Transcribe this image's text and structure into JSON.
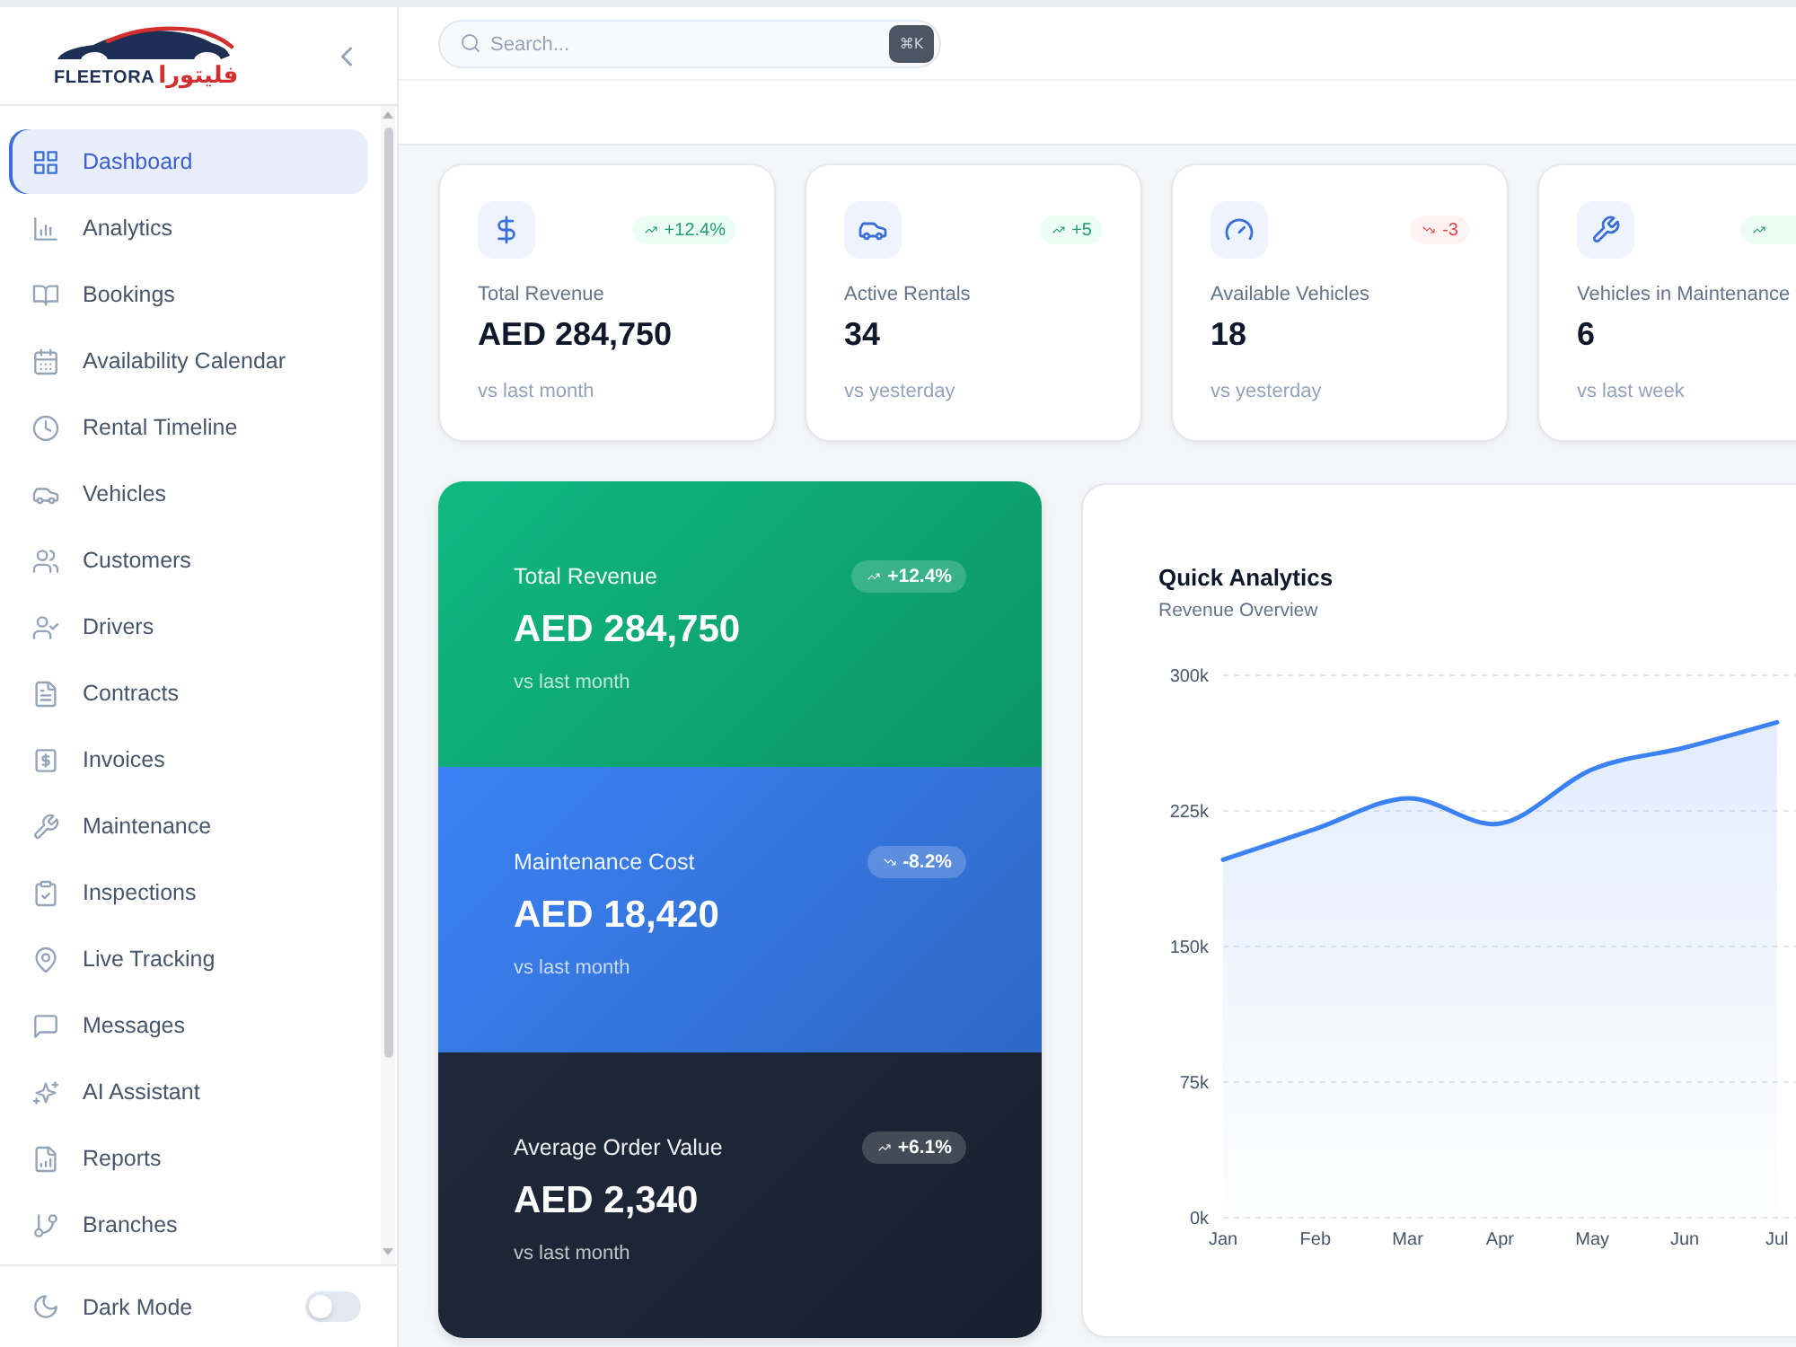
{
  "brand": {
    "name": "FLEETORA",
    "name_arabic": "فليتورا"
  },
  "sidebar": {
    "items": [
      {
        "label": "Dashboard",
        "selected": true
      },
      {
        "label": "Analytics",
        "selected": false
      },
      {
        "label": "Bookings",
        "selected": false
      },
      {
        "label": "Availability Calendar",
        "selected": false
      },
      {
        "label": "Rental Timeline",
        "selected": false
      },
      {
        "label": "Vehicles",
        "selected": false
      },
      {
        "label": "Customers",
        "selected": false
      },
      {
        "label": "Drivers",
        "selected": false
      },
      {
        "label": "Contracts",
        "selected": false
      },
      {
        "label": "Invoices",
        "selected": false
      },
      {
        "label": "Maintenance",
        "selected": false
      },
      {
        "label": "Inspections",
        "selected": false
      },
      {
        "label": "Live Tracking",
        "selected": false
      },
      {
        "label": "Messages",
        "selected": false
      },
      {
        "label": "AI Assistant",
        "selected": false
      },
      {
        "label": "Reports",
        "selected": false
      },
      {
        "label": "Branches",
        "selected": false
      }
    ]
  },
  "dark_mode": {
    "label": "Dark Mode",
    "on": false
  },
  "search": {
    "placeholder": "Search...",
    "shortcut": "⌘K"
  },
  "stat_cards": [
    {
      "label": "Total Revenue",
      "value": "AED 284,750",
      "note": "vs last month",
      "change": {
        "text": "+12.4%",
        "positive": true
      }
    },
    {
      "label": "Active Rentals",
      "value": "34",
      "note": "vs yesterday",
      "change": {
        "text": "+5",
        "positive": true
      }
    },
    {
      "label": "Available Vehicles",
      "value": "18",
      "note": "vs yesterday",
      "change": {
        "text": "-3",
        "positive": false
      }
    },
    {
      "label": "Vehicles in Maintenance",
      "value": "6",
      "note": "vs last week",
      "change": {
        "positive": true
      }
    }
  ],
  "highlight_cards": [
    {
      "label": "Total Revenue",
      "value": "AED 284,750",
      "note": "vs last month",
      "color": "#10b981",
      "change": {
        "text": "+12.4%",
        "positive": true
      }
    },
    {
      "label": "Maintenance Cost",
      "value": "AED 18,420",
      "note": "vs last month",
      "color": "#3b82f6",
      "change": {
        "text": "-8.2%",
        "positive": false
      }
    },
    {
      "label": "Average Order Value",
      "value": "AED 2,340",
      "note": "vs last month",
      "color": "#1e293b",
      "change": {
        "text": "+6.1%",
        "positive": true
      }
    }
  ],
  "analytics": {
    "subtitle": "Revenue Overview",
    "chart_data": {
      "type": "area",
      "title": "Quick Analytics",
      "categories": [
        "Jan",
        "Feb",
        "Mar",
        "Apr",
        "May",
        "Jun",
        "Jul"
      ],
      "series": [
        {
          "color": "#3b82f6",
          "values": [
            198000,
            215000,
            232000,
            218000,
            248000,
            260000,
            274000
          ]
        }
      ],
      "ylim": [
        0,
        300000
      ],
      "yticks": [
        {
          "value": 0,
          "label": "0k"
        },
        {
          "value": 75000,
          "label": "75k"
        },
        {
          "value": 150000,
          "label": "150k"
        },
        {
          "value": 225000,
          "label": "225k"
        },
        {
          "value": 300000,
          "label": "300k"
        }
      ],
      "grid": true
    }
  }
}
